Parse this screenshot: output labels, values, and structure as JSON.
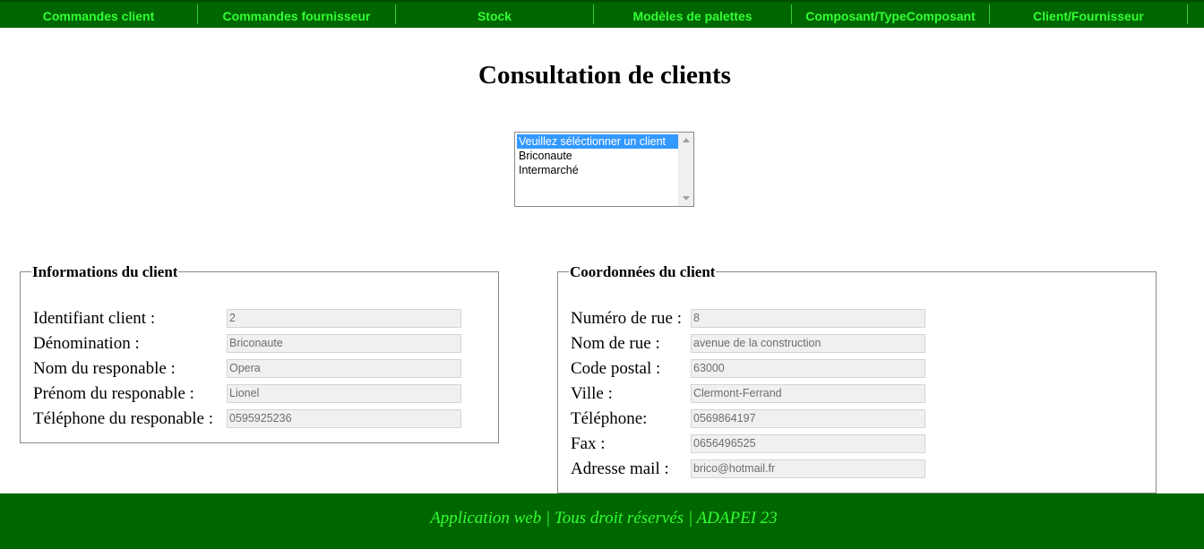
{
  "nav": {
    "items": [
      {
        "label": "Commandes client"
      },
      {
        "label": "Commandes fournisseur"
      },
      {
        "label": "Stock"
      },
      {
        "label": "Modèles de palettes"
      },
      {
        "label": "Composant/TypeComposant"
      },
      {
        "label": "Client/Fournisseur"
      }
    ]
  },
  "page": {
    "title": "Consultation de clients"
  },
  "client_select": {
    "options": [
      "Veuillez séléctionner un client",
      "Briconaute",
      "Intermarché"
    ],
    "selected": "Veuillez séléctionner un client"
  },
  "info": {
    "legend": "Informations du client",
    "fields": [
      {
        "label": "Identifiant client :",
        "value": "2"
      },
      {
        "label": "Dénomination :",
        "value": "Briconaute"
      },
      {
        "label": "Nom du responable :",
        "value": "Opera"
      },
      {
        "label": "Prénom du responable :",
        "value": "Lionel"
      },
      {
        "label": "Téléphone du responable :",
        "value": "0595925236"
      }
    ]
  },
  "coords": {
    "legend": "Coordonnées du client",
    "fields": [
      {
        "label": "Numéro de rue :",
        "value": "8"
      },
      {
        "label": "Nom de rue :",
        "value": "avenue de la construction"
      },
      {
        "label": "Code postal :",
        "value": "63000"
      },
      {
        "label": "Ville :",
        "value": "Clermont-Ferrand"
      },
      {
        "label": "Téléphone:",
        "value": "0569864197"
      },
      {
        "label": "Fax :",
        "value": "0656496525"
      },
      {
        "label": "Adresse mail :",
        "value": "brico@hotmail.fr"
      }
    ]
  },
  "footer": {
    "text": "Application web | Tous droit réservés | ADAPEI 23"
  },
  "colors": {
    "nav_bg": "#006600",
    "nav_text": "#33ff33",
    "selection": "#3399ff"
  }
}
